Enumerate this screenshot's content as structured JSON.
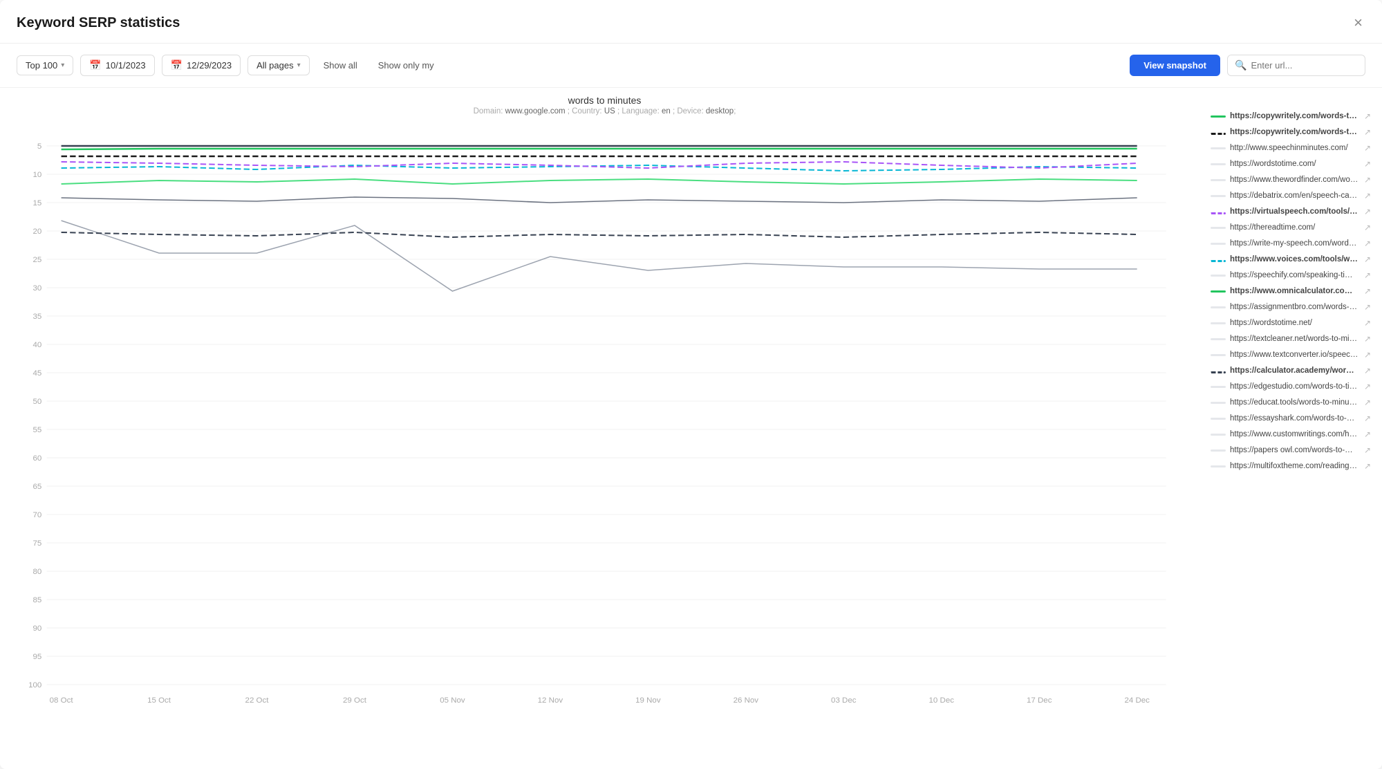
{
  "modal": {
    "title": "Keyword SERP statistics",
    "close_label": "×"
  },
  "toolbar": {
    "top_label": "Top 100",
    "date_start": "10/1/2023",
    "date_end": "12/29/2023",
    "all_pages_label": "All pages",
    "show_all_label": "Show all",
    "show_only_my_label": "Show only my",
    "view_snapshot_label": "View snapshot",
    "search_placeholder": "Enter url..."
  },
  "chart": {
    "title": "words to minutes",
    "subtitle_domain": "www.google.com",
    "subtitle_country": "US",
    "subtitle_language": "en",
    "subtitle_device": "desktop",
    "x_labels": [
      "08 Oct",
      "15 Oct",
      "22 Oct",
      "29 Oct",
      "05 Nov",
      "12 Nov",
      "19 Nov",
      "26 Nov",
      "03 Dec",
      "10 Dec",
      "17 Dec",
      "24 Dec"
    ],
    "y_labels": [
      "5",
      "10",
      "15",
      "20",
      "25",
      "30",
      "35",
      "40",
      "45",
      "50",
      "55",
      "60",
      "65",
      "70",
      "75",
      "80",
      "85",
      "90",
      "95",
      "100"
    ]
  },
  "legend": [
    {
      "url": "https://copywritely.com/words-to-pages/",
      "color": "#22c55e",
      "bold": true,
      "dashed": false
    },
    {
      "url": "https://copywritely.com/words-to-minutes/",
      "color": "#1a1a1a",
      "bold": true,
      "dashed": true
    },
    {
      "url": "http://www.speechinminutes.com/",
      "color": "",
      "bold": false,
      "dashed": false
    },
    {
      "url": "https://wordstotime.com/",
      "color": "",
      "bold": false,
      "dashed": false
    },
    {
      "url": "https://www.thewordfinder.com/words-to-mi...",
      "color": "",
      "bold": false,
      "dashed": false
    },
    {
      "url": "https://debatrix.com/en/speech-calculator/",
      "color": "",
      "bold": false,
      "dashed": false
    },
    {
      "url": "https://virtualspeech.com/tools/convert-word...",
      "color": "#a855f7",
      "bold": true,
      "dashed": true
    },
    {
      "url": "https://thereadtime.com/",
      "color": "",
      "bold": false,
      "dashed": false
    },
    {
      "url": "https://write-my-speech.com/words-to-minut...",
      "color": "",
      "bold": false,
      "dashed": false
    },
    {
      "url": "https://www.voices.com/tools/words_to_time_...",
      "color": "#06b6d4",
      "bold": true,
      "dashed": true
    },
    {
      "url": "https://speechify.com/speaking-time-calculat...",
      "color": "",
      "bold": false,
      "dashed": false
    },
    {
      "url": "https://www.omnicalculator.com/everyday-lif...",
      "color": "#22c55e",
      "bold": true,
      "dashed": false
    },
    {
      "url": "https://assignmentbro.com/words-to-minute...",
      "color": "",
      "bold": false,
      "dashed": false
    },
    {
      "url": "https://wordstotime.net/",
      "color": "",
      "bold": false,
      "dashed": false
    },
    {
      "url": "https://textcleaner.net/words-to-minutes/",
      "color": "",
      "bold": false,
      "dashed": false
    },
    {
      "url": "https://www.textconverter.io/speech-time/",
      "color": "",
      "bold": false,
      "dashed": false
    },
    {
      "url": "https://calculator.academy/words-to-minutes-...",
      "color": "#374151",
      "bold": true,
      "dashed": true
    },
    {
      "url": "https://edgestudio.com/words-to-time-calcul...",
      "color": "",
      "bold": false,
      "dashed": false
    },
    {
      "url": "https://educat.tools/words-to-minutes",
      "color": "",
      "bold": false,
      "dashed": false
    },
    {
      "url": "https://essayshark.com/words-to-minutes-co...",
      "color": "",
      "bold": false,
      "dashed": false
    },
    {
      "url": "https://www.customwritings.com/howtwrite...",
      "color": "",
      "bold": false,
      "dashed": false
    },
    {
      "url": "https://papers owl.com/words-to-minutes-con...",
      "color": "",
      "bold": false,
      "dashed": false
    },
    {
      "url": "https://multifoxtheme.com/reading-time-calc...",
      "color": "",
      "bold": false,
      "dashed": false
    }
  ]
}
